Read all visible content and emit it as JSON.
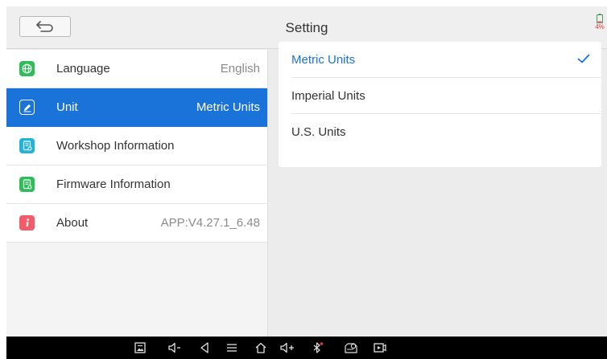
{
  "header": {
    "title": "Setting",
    "battery": "4%"
  },
  "menu": {
    "items": [
      {
        "label": "Language",
        "value": "English",
        "icon": "globe-icon",
        "color": "#2fbd5b"
      },
      {
        "label": "Unit",
        "value": "Metric Units",
        "icon": "pencil-icon",
        "color": "#1a73d9",
        "active": true
      },
      {
        "label": "Workshop Information",
        "value": "",
        "icon": "document-icon",
        "color": "#23b3d9"
      },
      {
        "label": "Firmware Information",
        "value": "",
        "icon": "document-icon",
        "color": "#2fbd5b"
      },
      {
        "label": "About",
        "value": "APP:V4.27.1_6.48",
        "icon": "info-icon",
        "color": "#f25c6a"
      }
    ]
  },
  "units": {
    "options": [
      "Metric Units",
      "Imperial Units",
      "U.S. Units"
    ],
    "selected": "Metric Units"
  },
  "colors": {
    "accent": "#1a73d9",
    "background": "#ececec",
    "sysbar": "#000000"
  }
}
